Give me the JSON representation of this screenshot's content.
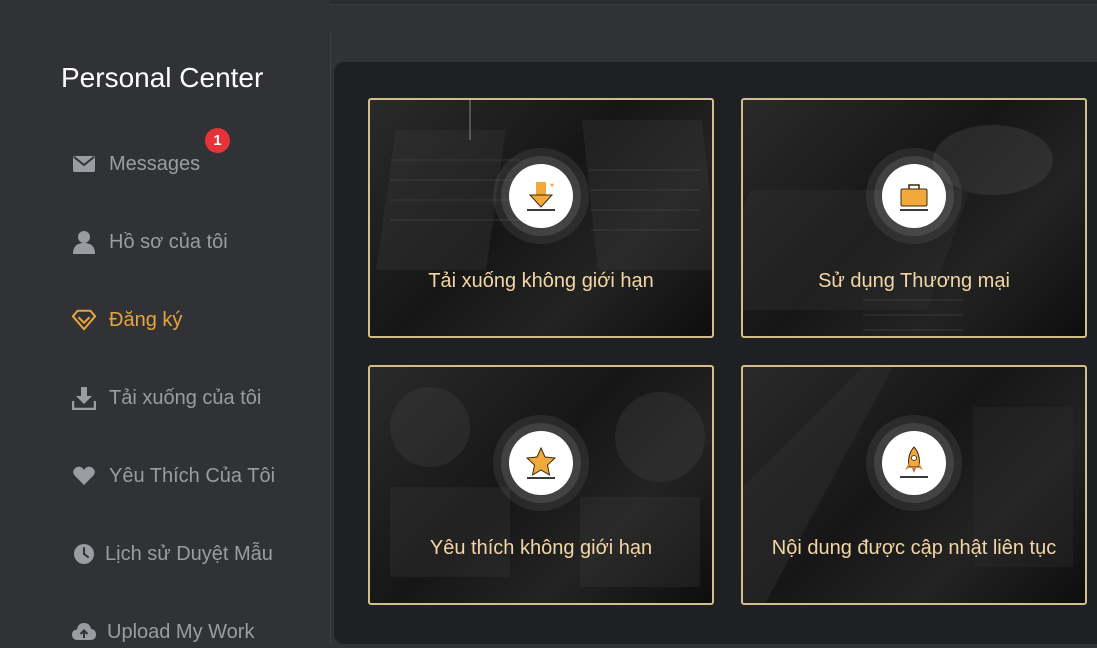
{
  "sidebar": {
    "title": "Personal Center",
    "items": [
      {
        "label": "Messages",
        "icon": "mail-icon",
        "badge": "1"
      },
      {
        "label": "Hồ sơ của tôi",
        "icon": "user-icon"
      },
      {
        "label": "Đăng ký",
        "icon": "diamond-icon",
        "active": true
      },
      {
        "label": "Tải xuống của tôi",
        "icon": "download-icon"
      },
      {
        "label": "Yêu Thích Của Tôi",
        "icon": "heart-icon"
      },
      {
        "label": "Lịch sử Duyệt Mẫu",
        "icon": "clock-icon"
      },
      {
        "label": "Upload My Work",
        "icon": "cloud-upload-icon"
      }
    ]
  },
  "cards": [
    {
      "label": "Tải xuống không giới hạn",
      "icon": "download-arrow-icon"
    },
    {
      "label": "Sử dụng Thương mại",
      "icon": "briefcase-icon"
    },
    {
      "label": "Yêu thích không giới hạn",
      "icon": "star-icon"
    },
    {
      "label": "Nội dung được cập nhật liên tục",
      "icon": "rocket-icon"
    }
  ],
  "colors": {
    "accent": "#e8a33c",
    "card_border": "#d3bd8b",
    "card_text": "#f3d6a5",
    "badge": "#e8323a"
  }
}
